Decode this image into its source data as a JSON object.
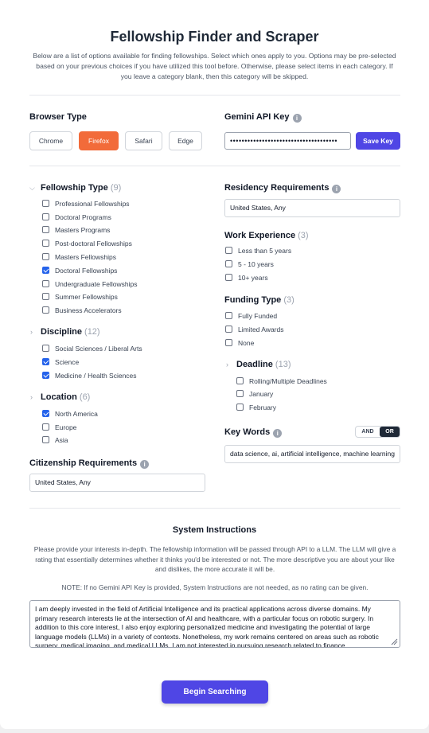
{
  "header": {
    "title": "Fellowship Finder and Scraper",
    "intro": "Below are a list of options available for finding fellowships. Select which ones apply to you. Options may be pre-selected based on your previous choices if you have utilized this tool before. Otherwise, please select items in each category. If you leave a category blank, then this category will be skipped."
  },
  "browser": {
    "label": "Browser Type",
    "options": [
      "Chrome",
      "Firefox",
      "Safari",
      "Edge"
    ],
    "selected": "Firefox"
  },
  "gemini": {
    "label": "Gemini API Key",
    "masked_value": "•••••••••••••••••••••••••••••••••••••",
    "save_label": "Save Key"
  },
  "fellowship_type": {
    "label": "Fellowship Type",
    "count": "(9)",
    "options": [
      {
        "label": "Professional Fellowships",
        "checked": false
      },
      {
        "label": "Doctoral Programs",
        "checked": false
      },
      {
        "label": "Masters Programs",
        "checked": false
      },
      {
        "label": "Post-doctoral Fellowships",
        "checked": false
      },
      {
        "label": "Masters Fellowships",
        "checked": false
      },
      {
        "label": "Doctoral Fellowships",
        "checked": true
      },
      {
        "label": "Undergraduate Fellowships",
        "checked": false
      },
      {
        "label": "Summer Fellowships",
        "checked": false
      },
      {
        "label": "Business Accelerators",
        "checked": false
      }
    ]
  },
  "discipline": {
    "label": "Discipline",
    "count": "(12)",
    "options": [
      {
        "label": "Social Sciences / Liberal Arts",
        "checked": false
      },
      {
        "label": "Science",
        "checked": true
      },
      {
        "label": "Medicine / Health Sciences",
        "checked": true
      }
    ]
  },
  "location": {
    "label": "Location",
    "count": "(6)",
    "options": [
      {
        "label": "North America",
        "checked": true
      },
      {
        "label": "Europe",
        "checked": false
      },
      {
        "label": "Asia",
        "checked": false
      }
    ]
  },
  "citizenship": {
    "label": "Citizenship Requirements",
    "value": "United States, Any"
  },
  "residency": {
    "label": "Residency Requirements",
    "value": "United States, Any"
  },
  "work_experience": {
    "label": "Work Experience",
    "count": "(3)",
    "options": [
      {
        "label": "Less than 5 years",
        "checked": false
      },
      {
        "label": "5 - 10 years",
        "checked": false
      },
      {
        "label": "10+ years",
        "checked": false
      }
    ]
  },
  "funding_type": {
    "label": "Funding Type",
    "count": "(3)",
    "options": [
      {
        "label": "Fully Funded",
        "checked": false
      },
      {
        "label": "Limited Awards",
        "checked": false
      },
      {
        "label": "None",
        "checked": false
      }
    ]
  },
  "deadline": {
    "label": "Deadline",
    "count": "(13)",
    "options": [
      {
        "label": "Rolling/Multiple Deadlines",
        "checked": false
      },
      {
        "label": "January",
        "checked": false
      },
      {
        "label": "February",
        "checked": false
      }
    ]
  },
  "keywords": {
    "label": "Key Words",
    "and_label": "AND",
    "or_label": "OR",
    "selected_mode": "OR",
    "value": "data science, ai, artificial intelligence, machine learning"
  },
  "system": {
    "title": "System Instructions",
    "description": "Please provide your interests in-depth. The fellowship information will be passed through API to a LLM. The LLM will give a rating that essentially determines whether it thinks you'd be interested or not. The more descriptive you are about your like and dislikes, the more accurate it will be.",
    "note": "NOTE: If no Gemini API Key is provided, System Instructions are not needed, as no rating can be given.",
    "value": "I am deeply invested in the field of Artificial Intelligence and its practical applications across diverse domains. My primary research interests lie at the intersection of AI and healthcare, with a particular focus on robotic surgery. In addition to this core interest, I also enjoy exploring personalized medicine and investigating the potential of large language models (LLMs) in a variety of contexts. Nonetheless, my work remains centered on areas such as robotic surgery, medical imaging, and medical LLMs. I am not interested in pursuing research related to finance."
  },
  "begin_label": "Begin Searching",
  "colors": {
    "primary": "#4f46e5",
    "browser_active": "#f26b3a",
    "checkbox_checked": "#2563eb"
  }
}
